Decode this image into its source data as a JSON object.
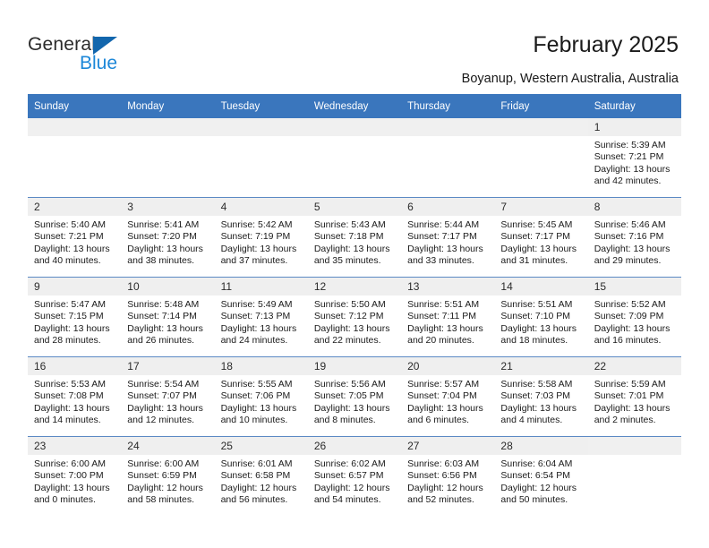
{
  "brand": {
    "name_part1": "General",
    "name_part2": "Blue",
    "accent_color": "#1c87d8",
    "triangle_color": "#1266ad"
  },
  "header": {
    "title": "February 2025",
    "subtitle": "Boyanup, Western Australia, Australia"
  },
  "calendar": {
    "header_bg": "#3a76bd",
    "weekday_headers": [
      "Sunday",
      "Monday",
      "Tuesday",
      "Wednesday",
      "Thursday",
      "Friday",
      "Saturday"
    ],
    "weeks": [
      [
        {
          "day": "",
          "sunrise": "",
          "sunset": "",
          "daylight_line1": "",
          "daylight_line2": ""
        },
        {
          "day": "",
          "sunrise": "",
          "sunset": "",
          "daylight_line1": "",
          "daylight_line2": ""
        },
        {
          "day": "",
          "sunrise": "",
          "sunset": "",
          "daylight_line1": "",
          "daylight_line2": ""
        },
        {
          "day": "",
          "sunrise": "",
          "sunset": "",
          "daylight_line1": "",
          "daylight_line2": ""
        },
        {
          "day": "",
          "sunrise": "",
          "sunset": "",
          "daylight_line1": "",
          "daylight_line2": ""
        },
        {
          "day": "",
          "sunrise": "",
          "sunset": "",
          "daylight_line1": "",
          "daylight_line2": ""
        },
        {
          "day": "1",
          "sunrise": "Sunrise: 5:39 AM",
          "sunset": "Sunset: 7:21 PM",
          "daylight_line1": "Daylight: 13 hours",
          "daylight_line2": "and 42 minutes."
        }
      ],
      [
        {
          "day": "2",
          "sunrise": "Sunrise: 5:40 AM",
          "sunset": "Sunset: 7:21 PM",
          "daylight_line1": "Daylight: 13 hours",
          "daylight_line2": "and 40 minutes."
        },
        {
          "day": "3",
          "sunrise": "Sunrise: 5:41 AM",
          "sunset": "Sunset: 7:20 PM",
          "daylight_line1": "Daylight: 13 hours",
          "daylight_line2": "and 38 minutes."
        },
        {
          "day": "4",
          "sunrise": "Sunrise: 5:42 AM",
          "sunset": "Sunset: 7:19 PM",
          "daylight_line1": "Daylight: 13 hours",
          "daylight_line2": "and 37 minutes."
        },
        {
          "day": "5",
          "sunrise": "Sunrise: 5:43 AM",
          "sunset": "Sunset: 7:18 PM",
          "daylight_line1": "Daylight: 13 hours",
          "daylight_line2": "and 35 minutes."
        },
        {
          "day": "6",
          "sunrise": "Sunrise: 5:44 AM",
          "sunset": "Sunset: 7:17 PM",
          "daylight_line1": "Daylight: 13 hours",
          "daylight_line2": "and 33 minutes."
        },
        {
          "day": "7",
          "sunrise": "Sunrise: 5:45 AM",
          "sunset": "Sunset: 7:17 PM",
          "daylight_line1": "Daylight: 13 hours",
          "daylight_line2": "and 31 minutes."
        },
        {
          "day": "8",
          "sunrise": "Sunrise: 5:46 AM",
          "sunset": "Sunset: 7:16 PM",
          "daylight_line1": "Daylight: 13 hours",
          "daylight_line2": "and 29 minutes."
        }
      ],
      [
        {
          "day": "9",
          "sunrise": "Sunrise: 5:47 AM",
          "sunset": "Sunset: 7:15 PM",
          "daylight_line1": "Daylight: 13 hours",
          "daylight_line2": "and 28 minutes."
        },
        {
          "day": "10",
          "sunrise": "Sunrise: 5:48 AM",
          "sunset": "Sunset: 7:14 PM",
          "daylight_line1": "Daylight: 13 hours",
          "daylight_line2": "and 26 minutes."
        },
        {
          "day": "11",
          "sunrise": "Sunrise: 5:49 AM",
          "sunset": "Sunset: 7:13 PM",
          "daylight_line1": "Daylight: 13 hours",
          "daylight_line2": "and 24 minutes."
        },
        {
          "day": "12",
          "sunrise": "Sunrise: 5:50 AM",
          "sunset": "Sunset: 7:12 PM",
          "daylight_line1": "Daylight: 13 hours",
          "daylight_line2": "and 22 minutes."
        },
        {
          "day": "13",
          "sunrise": "Sunrise: 5:51 AM",
          "sunset": "Sunset: 7:11 PM",
          "daylight_line1": "Daylight: 13 hours",
          "daylight_line2": "and 20 minutes."
        },
        {
          "day": "14",
          "sunrise": "Sunrise: 5:51 AM",
          "sunset": "Sunset: 7:10 PM",
          "daylight_line1": "Daylight: 13 hours",
          "daylight_line2": "and 18 minutes."
        },
        {
          "day": "15",
          "sunrise": "Sunrise: 5:52 AM",
          "sunset": "Sunset: 7:09 PM",
          "daylight_line1": "Daylight: 13 hours",
          "daylight_line2": "and 16 minutes."
        }
      ],
      [
        {
          "day": "16",
          "sunrise": "Sunrise: 5:53 AM",
          "sunset": "Sunset: 7:08 PM",
          "daylight_line1": "Daylight: 13 hours",
          "daylight_line2": "and 14 minutes."
        },
        {
          "day": "17",
          "sunrise": "Sunrise: 5:54 AM",
          "sunset": "Sunset: 7:07 PM",
          "daylight_line1": "Daylight: 13 hours",
          "daylight_line2": "and 12 minutes."
        },
        {
          "day": "18",
          "sunrise": "Sunrise: 5:55 AM",
          "sunset": "Sunset: 7:06 PM",
          "daylight_line1": "Daylight: 13 hours",
          "daylight_line2": "and 10 minutes."
        },
        {
          "day": "19",
          "sunrise": "Sunrise: 5:56 AM",
          "sunset": "Sunset: 7:05 PM",
          "daylight_line1": "Daylight: 13 hours",
          "daylight_line2": "and 8 minutes."
        },
        {
          "day": "20",
          "sunrise": "Sunrise: 5:57 AM",
          "sunset": "Sunset: 7:04 PM",
          "daylight_line1": "Daylight: 13 hours",
          "daylight_line2": "and 6 minutes."
        },
        {
          "day": "21",
          "sunrise": "Sunrise: 5:58 AM",
          "sunset": "Sunset: 7:03 PM",
          "daylight_line1": "Daylight: 13 hours",
          "daylight_line2": "and 4 minutes."
        },
        {
          "day": "22",
          "sunrise": "Sunrise: 5:59 AM",
          "sunset": "Sunset: 7:01 PM",
          "daylight_line1": "Daylight: 13 hours",
          "daylight_line2": "and 2 minutes."
        }
      ],
      [
        {
          "day": "23",
          "sunrise": "Sunrise: 6:00 AM",
          "sunset": "Sunset: 7:00 PM",
          "daylight_line1": "Daylight: 13 hours",
          "daylight_line2": "and 0 minutes."
        },
        {
          "day": "24",
          "sunrise": "Sunrise: 6:00 AM",
          "sunset": "Sunset: 6:59 PM",
          "daylight_line1": "Daylight: 12 hours",
          "daylight_line2": "and 58 minutes."
        },
        {
          "day": "25",
          "sunrise": "Sunrise: 6:01 AM",
          "sunset": "Sunset: 6:58 PM",
          "daylight_line1": "Daylight: 12 hours",
          "daylight_line2": "and 56 minutes."
        },
        {
          "day": "26",
          "sunrise": "Sunrise: 6:02 AM",
          "sunset": "Sunset: 6:57 PM",
          "daylight_line1": "Daylight: 12 hours",
          "daylight_line2": "and 54 minutes."
        },
        {
          "day": "27",
          "sunrise": "Sunrise: 6:03 AM",
          "sunset": "Sunset: 6:56 PM",
          "daylight_line1": "Daylight: 12 hours",
          "daylight_line2": "and 52 minutes."
        },
        {
          "day": "28",
          "sunrise": "Sunrise: 6:04 AM",
          "sunset": "Sunset: 6:54 PM",
          "daylight_line1": "Daylight: 12 hours",
          "daylight_line2": "and 50 minutes."
        },
        {
          "day": "",
          "sunrise": "",
          "sunset": "",
          "daylight_line1": "",
          "daylight_line2": ""
        }
      ]
    ]
  }
}
